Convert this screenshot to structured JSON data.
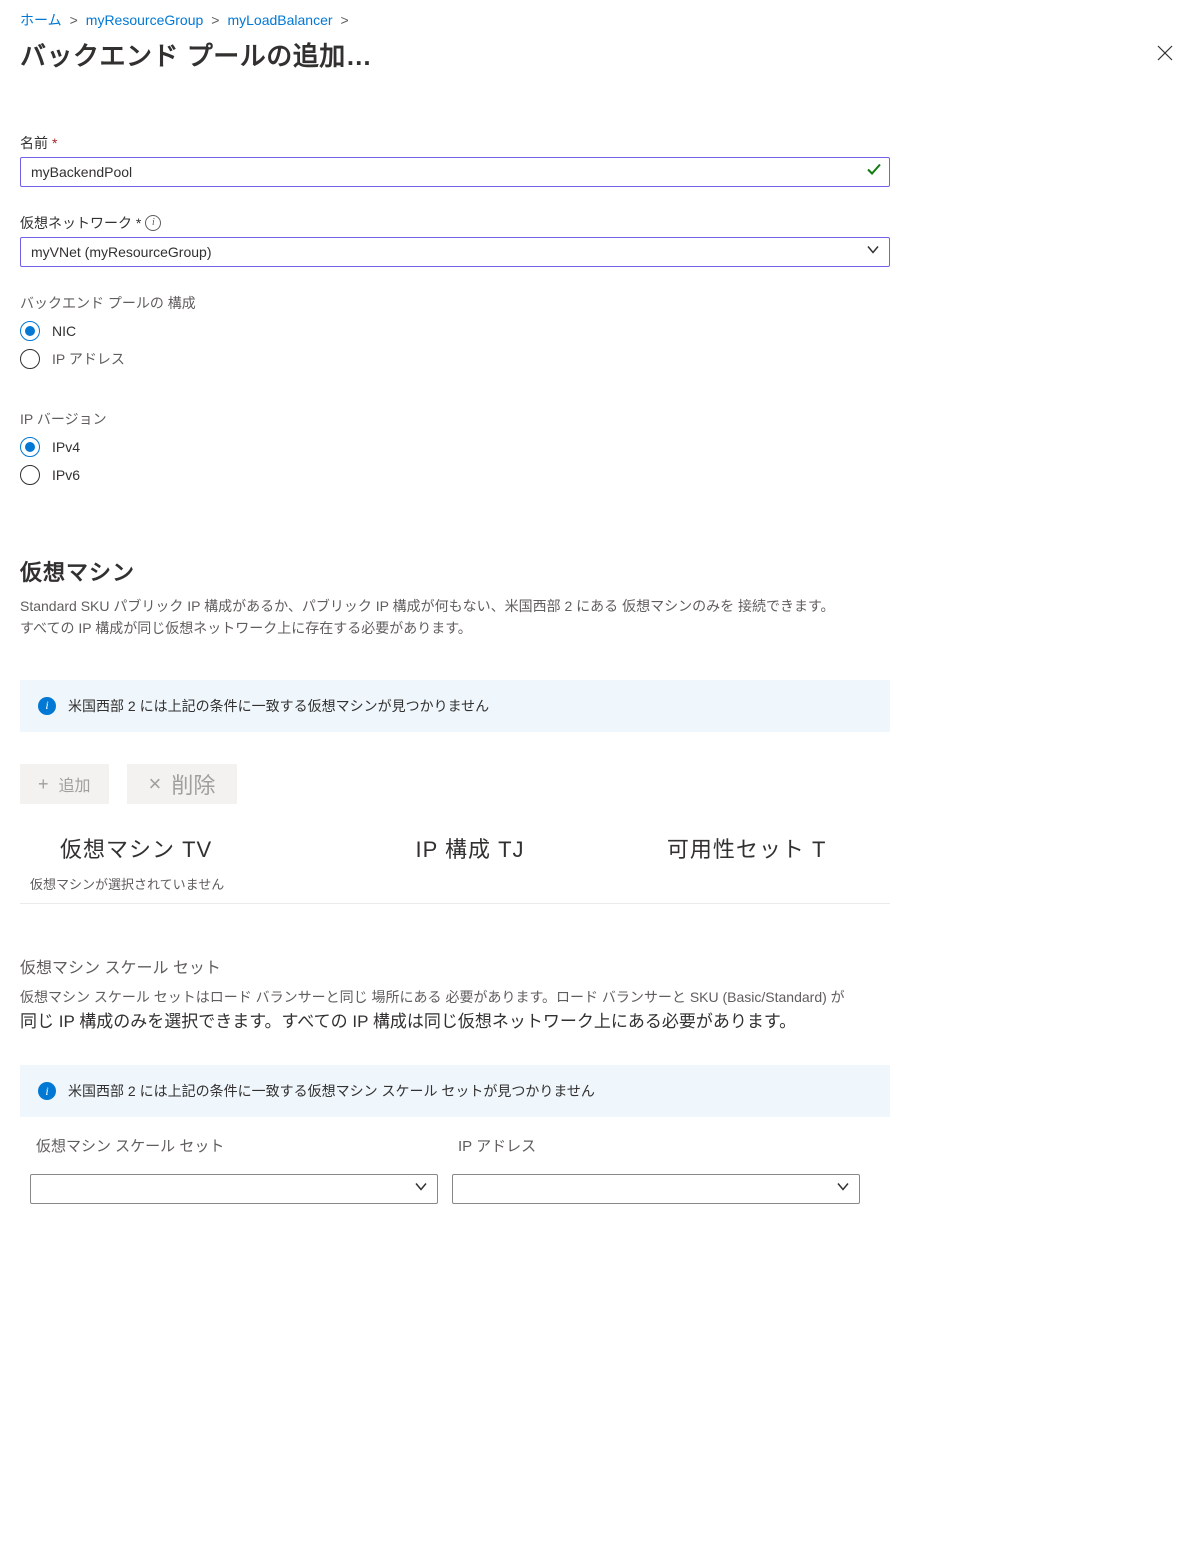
{
  "breadcrumb": {
    "home": "ホーム",
    "rg": "myResourceGroup",
    "lb": "myLoadBalancer"
  },
  "title": "バックエンド プールの追加…",
  "fields": {
    "nameLabel": "名前",
    "nameValue": "myBackendPool",
    "vnetLabel": "仮想ネットワーク *",
    "vnetValue": "myVNet (myResourceGroup)",
    "poolConfigLabel": "バックエンド プールの 構成",
    "nic": "NIC",
    "ipaddr": "IP アドレス",
    "ipVersionLabel": "IP バージョン",
    "ipv4": "IPv4",
    "ipv6": "IPv6"
  },
  "vm": {
    "heading": "仮想マシン",
    "desc1": "Standard SKU パブリック IP 構成があるか、パブリック IP 構成が何もない、米国西部 2 にある 仮想マシンのみを 接続できます。",
    "desc2": "すべての IP 構成が同じ仮想ネットワーク上に存在する必要があります。",
    "banner": "米国西部 2 には上記の条件に一致する仮想マシンが見つかりません",
    "addBtn": "追加",
    "delBtn": "削除",
    "colVm": "仮想マシン TV",
    "colIp": "IP 構成 TJ",
    "colAvail": "可用性セット T",
    "emptyMsg": "仮想マシンが選択されていません"
  },
  "vmss": {
    "heading": "仮想マシン スケール セット",
    "desc1": "仮想マシン スケール セットはロード バランサーと同じ 場所にある 必要があります。ロード バランサーと SKU (Basic/Standard) が",
    "desc2": "同じ IP 構成のみを選択できます。すべての IP 構成は同じ仮想ネットワーク上にある必要があります。",
    "banner": "米国西部 2 には上記の条件に一致する仮想マシン スケール セットが見つかりません",
    "colVmss": "仮想マシン スケール セット",
    "colIp": "IP アドレス"
  }
}
